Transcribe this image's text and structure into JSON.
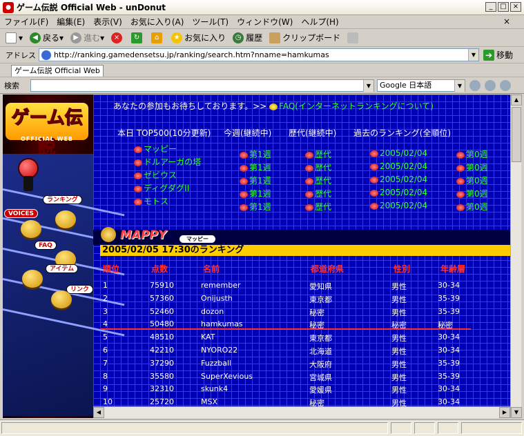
{
  "window": {
    "title": "ゲーム伝説 Official Web - unDonut"
  },
  "menu": [
    "ファイル(F)",
    "編集(E)",
    "表示(V)",
    "お気に入り(A)",
    "ツール(T)",
    "ウィンドウ(W)",
    "ヘルプ(H)"
  ],
  "toolbar": {
    "back": "戻る",
    "forward": "進む",
    "favorites": "お気に入り",
    "history": "履歴",
    "clipboard": "クリップボード"
  },
  "address": {
    "label": "アドレス",
    "url": "http://ranking.gamedensetsu.jp/ranking/search.htm?nname=hamkumas",
    "go": "移動"
  },
  "tab": {
    "label": "ゲーム伝説 Official Web"
  },
  "search": {
    "label": "検索",
    "engine": "Google 日本語"
  },
  "site": {
    "logo": "ゲーム伝説",
    "logo_sub": "OFFICIAL WEB",
    "nav": {
      "ranking": "ランキング",
      "voices": "VOICES",
      "faq": "FAQ",
      "item": "アイテム",
      "link": "リンク"
    },
    "invite": "あなたの参加もお待ちしております。>>",
    "faq_link": "FAQ(インターネットランキングについて)",
    "headers": [
      "本日 TOP500(10分更新)",
      "今週(継続中)",
      "歴代(継続中)",
      "過去のランキング(全順位)"
    ],
    "games": [
      "マッピー",
      "ドルアーガの塔",
      "ゼビウス",
      "ディグダグII",
      "モトス"
    ],
    "week": [
      "第1週",
      "第1週",
      "第1週",
      "第1週",
      "第1週"
    ],
    "alltime": [
      "歴代",
      "歴代",
      "歴代",
      "歴代",
      "歴代"
    ],
    "pastdate": [
      "2005/02/04",
      "2005/02/04",
      "2005/02/04",
      "2005/02/04",
      "2005/02/04"
    ],
    "pastweek": [
      "第0週",
      "第0週",
      "第0週",
      "第0週",
      "第0週"
    ]
  },
  "mappy": {
    "title": "MAPPY",
    "tag": "マッピー",
    "date_heading": "2005/02/05 17:30のランキング"
  },
  "table": {
    "columns": [
      "順位",
      "点数",
      "名前",
      "都道府県",
      "性別",
      "年齢層"
    ],
    "rows": [
      [
        "1",
        "75910",
        "remember",
        "愛知県",
        "男性",
        "30-34"
      ],
      [
        "2",
        "57360",
        "Onijusth",
        "東京都",
        "男性",
        "35-39"
      ],
      [
        "3",
        "52460",
        "dozon",
        "秘密",
        "男性",
        "35-39"
      ],
      [
        "4",
        "50480",
        "hamkumas",
        "秘密",
        "秘密",
        "秘密"
      ],
      [
        "5",
        "48510",
        "KAT",
        "東京都",
        "男性",
        "30-34"
      ],
      [
        "6",
        "42210",
        "NYORO22",
        "北海道",
        "男性",
        "30-34"
      ],
      [
        "7",
        "37290",
        "Fuzzball",
        "大阪府",
        "男性",
        "35-39"
      ],
      [
        "8",
        "35580",
        "SuperXevious",
        "宮城県",
        "男性",
        "35-39"
      ],
      [
        "9",
        "32310",
        "skunk4",
        "愛媛県",
        "男性",
        "30-34"
      ],
      [
        "10",
        "25720",
        "MSX",
        "秘密",
        "男性",
        "30-34"
      ]
    ]
  }
}
